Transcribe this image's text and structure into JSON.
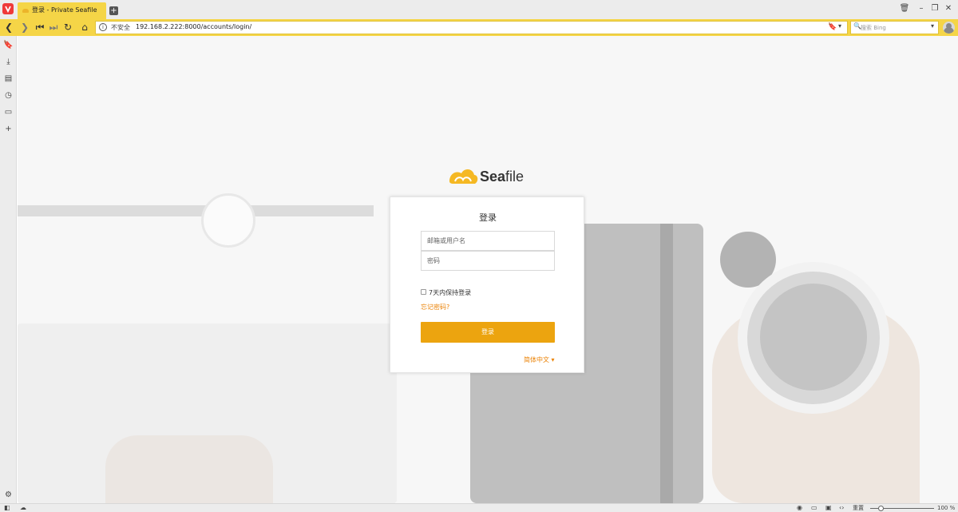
{
  "browser": {
    "tab_title": "登录 - Private Seafile",
    "new_tab_icon": "+",
    "security_label": "不安全",
    "url": "192.168.2.222:8000/accounts/login/",
    "search_placeholder": "搜索 Bing",
    "zoom_label": "重置",
    "zoom_level": "100 %",
    "accent_color": "#f5d547"
  },
  "logo": {
    "brand_bold": "Sea",
    "brand_rest": "file"
  },
  "login": {
    "title": "登录",
    "username_placeholder": "邮箱或用户名",
    "password_placeholder": "密码",
    "remember_label": "7天内保持登录",
    "remember_checked": false,
    "forgot_link": "忘记密码?",
    "submit_label": "登录",
    "language": "简体中文 ▾",
    "accent_color": "#eca40f"
  }
}
